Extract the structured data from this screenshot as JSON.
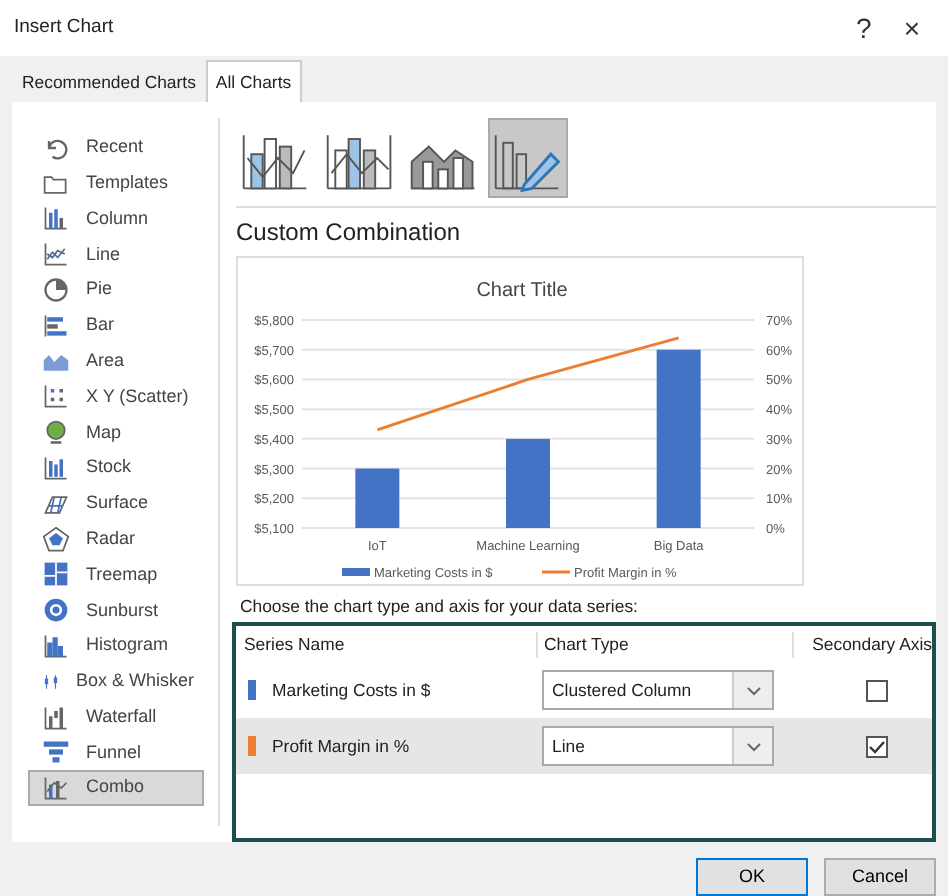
{
  "window": {
    "title": "Insert Chart",
    "help": "?",
    "close": "×"
  },
  "tabs": [
    {
      "label": "Recommended Charts",
      "selected": false
    },
    {
      "label": "All Charts",
      "selected": true
    }
  ],
  "sidebar": {
    "items": [
      {
        "label": "Recent",
        "selected": false
      },
      {
        "label": "Templates",
        "selected": false
      },
      {
        "label": "Column",
        "selected": false
      },
      {
        "label": "Line",
        "selected": false
      },
      {
        "label": "Pie",
        "selected": false
      },
      {
        "label": "Bar",
        "selected": false
      },
      {
        "label": "Area",
        "selected": false
      },
      {
        "label": "X Y (Scatter)",
        "selected": false
      },
      {
        "label": "Map",
        "selected": false
      },
      {
        "label": "Stock",
        "selected": false
      },
      {
        "label": "Surface",
        "selected": false
      },
      {
        "label": "Radar",
        "selected": false
      },
      {
        "label": "Treemap",
        "selected": false
      },
      {
        "label": "Sunburst",
        "selected": false
      },
      {
        "label": "Histogram",
        "selected": false
      },
      {
        "label": "Box & Whisker",
        "selected": false
      },
      {
        "label": "Waterfall",
        "selected": false
      },
      {
        "label": "Funnel",
        "selected": false
      },
      {
        "label": "Combo",
        "selected": true
      }
    ]
  },
  "subtypes": [
    {
      "selected": false
    },
    {
      "selected": false
    },
    {
      "selected": false
    },
    {
      "selected": true
    }
  ],
  "heading": "Custom Combination",
  "preview": {
    "layers": [
      {
        "chart_data": {
          "type": "bar",
          "title": "Chart Title",
          "categories": [
            "IoT",
            "Machine Learning",
            "Big Data"
          ],
          "series": [
            {
              "name": "Marketing Costs in $",
              "color": "#4472c4",
              "values": [
                5300,
                5400,
                5700
              ]
            }
          ],
          "ylim": [
            5100,
            5800
          ],
          "grid": true,
          "yticks": [
            {
              "value": 5100,
              "label": "$5,100"
            },
            {
              "value": 5200,
              "label": "$5,200"
            },
            {
              "value": 5300,
              "label": "$5,300"
            },
            {
              "value": 5400,
              "label": "$5,400"
            },
            {
              "value": 5500,
              "label": "$5,500"
            },
            {
              "value": 5600,
              "label": "$5,600"
            },
            {
              "value": 5700,
              "label": "$5,700"
            },
            {
              "value": 5800,
              "label": "$5,800"
            }
          ]
        }
      },
      {
        "chart_data": {
          "type": "line",
          "series": [
            {
              "name": "Profit Margin in %",
              "color": "#ed7d31",
              "values": [
                0.33,
                0.5,
                0.64
              ]
            }
          ],
          "ylim": [
            0,
            0.7
          ],
          "yticks": [
            {
              "value": 0,
              "label": "0%"
            },
            {
              "value": 0.1,
              "label": "10%"
            },
            {
              "value": 0.2,
              "label": "20%"
            },
            {
              "value": 0.3,
              "label": "30%"
            },
            {
              "value": 0.4,
              "label": "40%"
            },
            {
              "value": 0.5,
              "label": "50%"
            },
            {
              "value": 0.6,
              "label": "60%"
            },
            {
              "value": 0.7,
              "label": "70%"
            }
          ]
        }
      }
    ]
  },
  "series_table": {
    "caption": "Choose the chart type and axis for your data series:",
    "columns": [
      "Series Name",
      "Chart Type",
      "Secondary Axis"
    ],
    "rows": [
      {
        "name": "Marketing Costs in $",
        "color": "#4472c4",
        "chart_type": "Clustered Column",
        "secondary_axis": false,
        "selected": false
      },
      {
        "name": "Profit Margin in %",
        "color": "#ed7d31",
        "chart_type": "Line",
        "secondary_axis": true,
        "selected": true
      }
    ]
  },
  "buttons": [
    {
      "label": "OK",
      "default": true
    },
    {
      "label": "Cancel",
      "default": false
    }
  ]
}
